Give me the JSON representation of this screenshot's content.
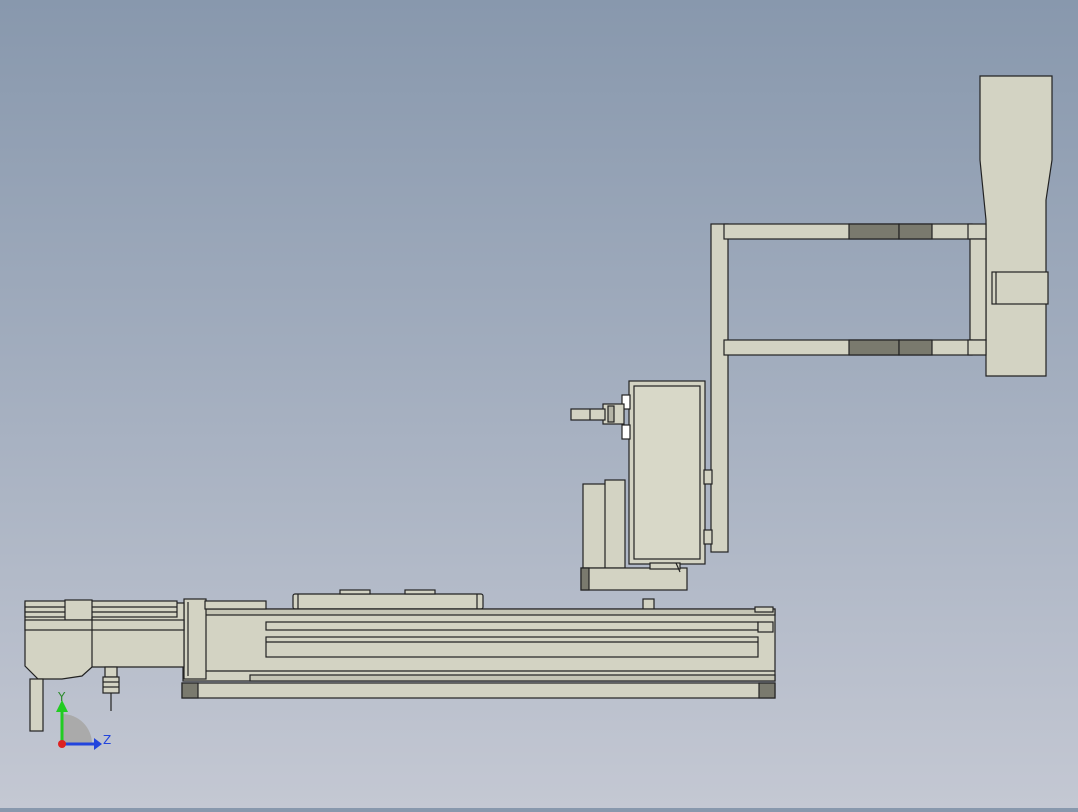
{
  "viewport": {
    "background_top": "#8898ad",
    "background_bottom": "#c4c8d3"
  },
  "model": {
    "part_color": "#d3d3c3",
    "part_shade": "#c5c5b5",
    "edge_color": "#222222",
    "accent_dark": "#7a7a6e",
    "accent_mid": "#b4b4a6"
  },
  "triad": {
    "y_label": "Y",
    "z_label": "Z",
    "y_color": "#22cc22",
    "z_color": "#2244dd",
    "x_color": "#dd2222"
  }
}
